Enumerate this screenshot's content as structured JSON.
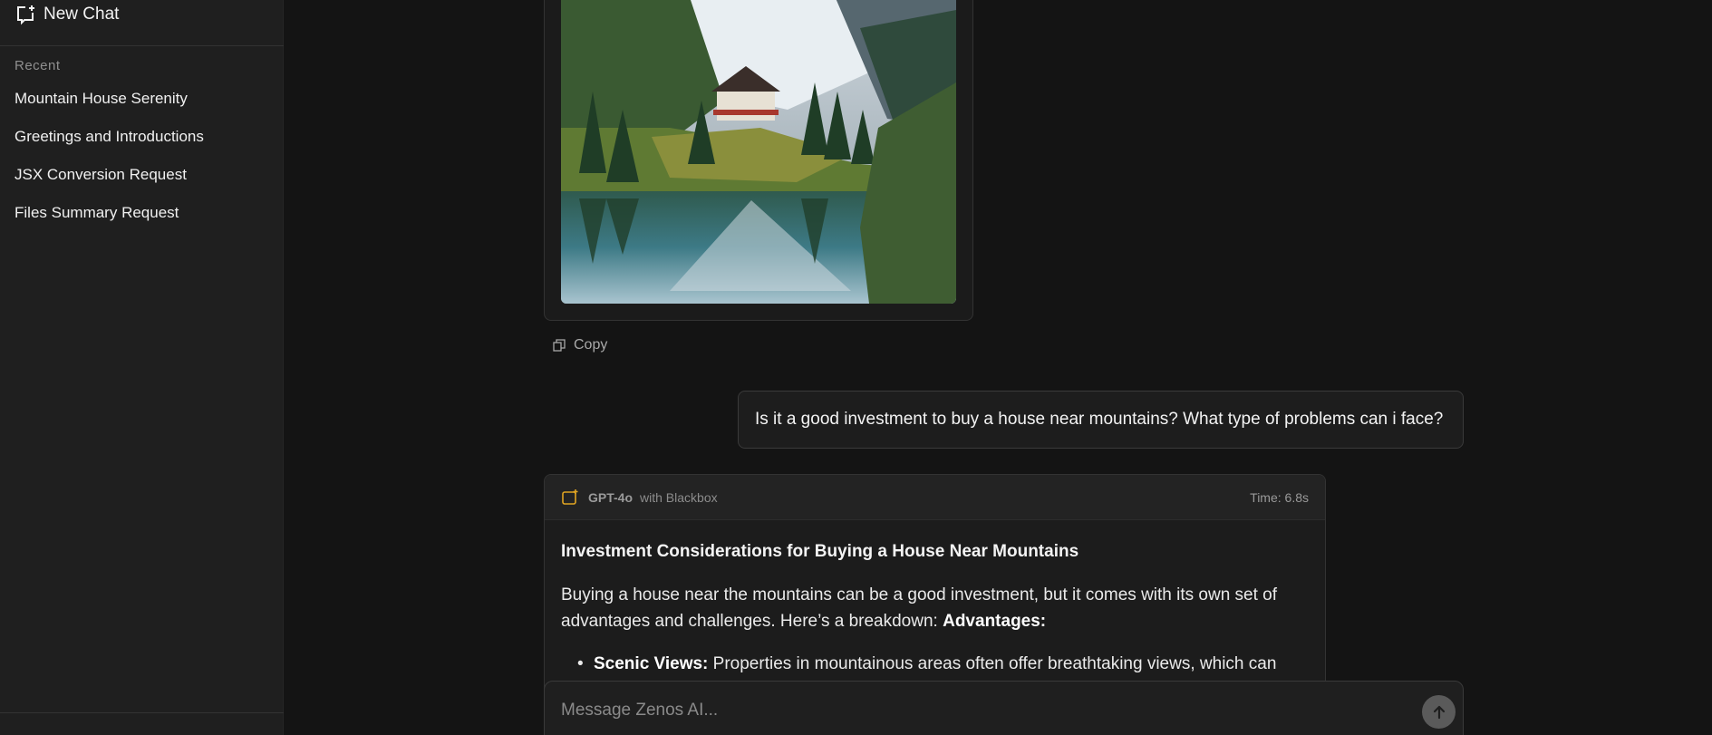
{
  "sidebar": {
    "new_chat_label": "New Chat",
    "recent_label": "Recent",
    "items": [
      {
        "label": "Mountain House Serenity"
      },
      {
        "label": "Greetings and Introductions"
      },
      {
        "label": "JSX Conversion Request"
      },
      {
        "label": "Files Summary Request"
      }
    ]
  },
  "conversation": {
    "copy_label": "Copy",
    "user_message": "Is it a good investment to buy a house near mountains? What type of problems can i face?",
    "response": {
      "model": "GPT-4o",
      "model_suffix": "with Blackbox",
      "time": "Time: 6.8s",
      "title": "Investment Considerations for Buying a House Near Mountains",
      "intro": "Buying a house near the mountains can be a good investment, but it comes with its own set of advantages and challenges. Here’s a breakdown:",
      "intro_bold": "Advantages:",
      "bullet_1_bold": "Scenic Views:",
      "bullet_1_text": "Properties in mountainous areas often offer breathtaking views, which can"
    }
  },
  "composer": {
    "placeholder": "Message Zenos AI..."
  },
  "colors": {
    "background": "#141414",
    "sidebar": "#1f1f1f",
    "accent_icon": "#e0a422"
  }
}
